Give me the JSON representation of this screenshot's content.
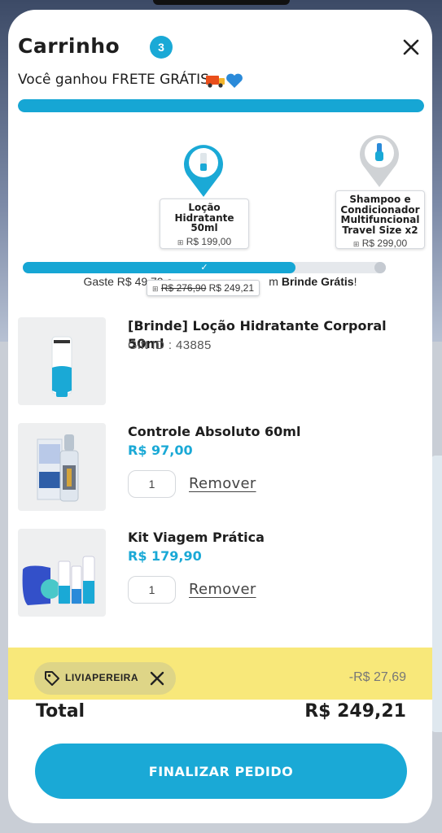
{
  "cart": {
    "title": "Carrinho",
    "count": "3",
    "free_shipping_msg": "Você ganhou FRETE GRÁTIS",
    "shipping_progress": 1.0
  },
  "gifts": {
    "milestones": [
      {
        "name": "Loção Hidratante 50ml",
        "price": "R$ 199,00",
        "reached": true
      },
      {
        "name": "Shampoo e Condicionador Multifuncional Travel Size x2",
        "price": "R$ 299,00",
        "reached": false
      }
    ],
    "progress": 0.75,
    "note_prefix": "Gaste R$ 49,79 a",
    "note_suffix": "m",
    "note_bold": "Brinde Grátis",
    "note_end": "!",
    "cart_tip_old": "R$ 276,90",
    "cart_tip_new": "R$ 249,21"
  },
  "items": [
    {
      "name": "[Brinde] Loção Hidratante Corporal 50ml",
      "sub": "Gift ID : 43885"
    },
    {
      "name": "Controle Absoluto 60ml",
      "price": "R$ 97,00",
      "qty": "1",
      "remove": "Remover"
    },
    {
      "name": "Kit Viagem Prática",
      "price": "R$ 179,90",
      "qty": "1",
      "remove": "Remover"
    }
  ],
  "coupon": {
    "code": "LIVIAPEREIRA",
    "discount": "-R$ 27,69"
  },
  "total": {
    "label": "Total",
    "value": "R$ 249,21"
  },
  "checkout": {
    "label": "FINALIZAR PEDIDO"
  },
  "colors": {
    "accent": "#1aa9d6",
    "highlight": "#f6e254"
  }
}
